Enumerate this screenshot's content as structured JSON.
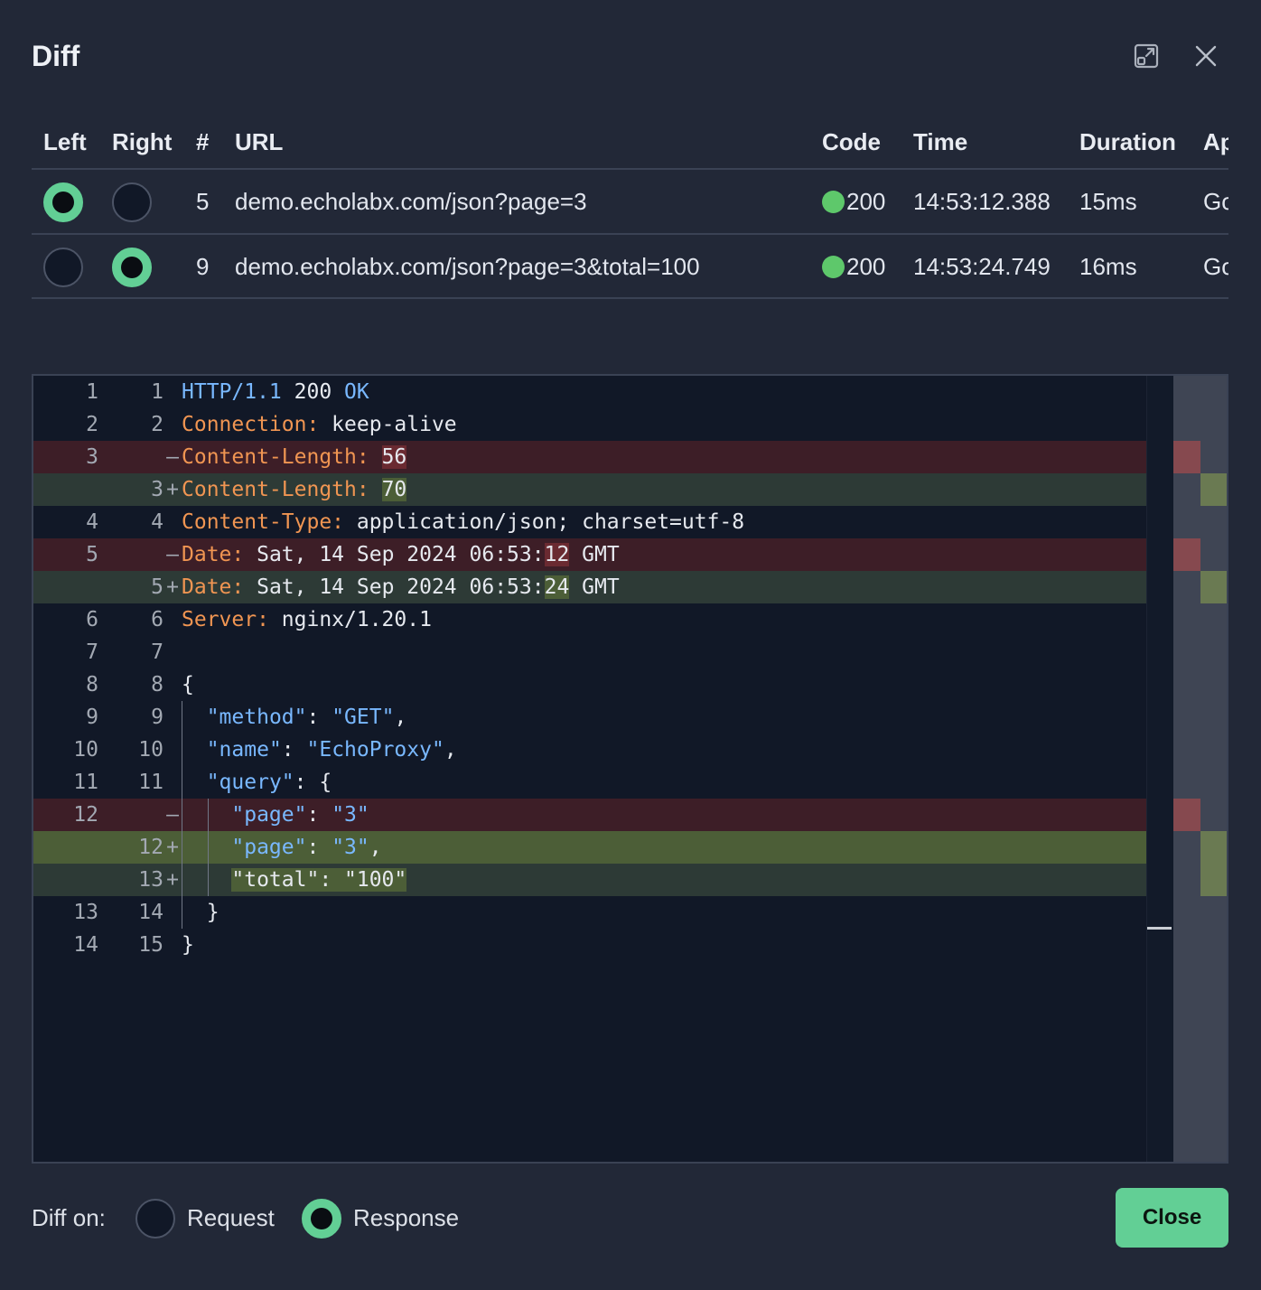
{
  "dialog": {
    "title": "Diff",
    "expand_icon": "expand-icon",
    "close_icon": "close-icon"
  },
  "table": {
    "headers": [
      "Left",
      "Right",
      "#",
      "URL",
      "Code",
      "Time",
      "Duration",
      "Ap"
    ],
    "rows": [
      {
        "left_selected": true,
        "right_selected": false,
        "num": "5",
        "url": "demo.echolabx.com/json?page=3",
        "code": "200",
        "time": "14:53:12.388",
        "duration": "15ms",
        "app": "Go"
      },
      {
        "left_selected": false,
        "right_selected": true,
        "num": "9",
        "url": "demo.echolabx.com/json?page=3&total=100",
        "code": "200",
        "time": "14:53:24.749",
        "duration": "16ms",
        "app": "Go"
      }
    ],
    "status_color": "#5ec86b"
  },
  "diff": {
    "lines": [
      {
        "l": "1",
        "r": "1",
        "mark": "",
        "type": "same",
        "parts": [
          [
            "b",
            "HTTP/1.1 "
          ],
          [
            "n",
            "200"
          ],
          [
            "b",
            " OK"
          ]
        ]
      },
      {
        "l": "2",
        "r": "2",
        "mark": "",
        "type": "same",
        "parts": [
          [
            "k",
            "Connection:"
          ],
          [
            "w",
            " keep-alive"
          ]
        ]
      },
      {
        "l": "3",
        "r": "",
        "mark": "—",
        "type": "del",
        "parts": [
          [
            "k",
            "Content-Length:"
          ],
          [
            "w",
            " "
          ],
          [
            "hd",
            "56"
          ]
        ]
      },
      {
        "l": "",
        "r": "3",
        "mark": "+",
        "type": "add",
        "parts": [
          [
            "k",
            "Content-Length:"
          ],
          [
            "w",
            " "
          ],
          [
            "ha",
            "70"
          ]
        ]
      },
      {
        "l": "4",
        "r": "4",
        "mark": "",
        "type": "same",
        "parts": [
          [
            "k",
            "Content-Type:"
          ],
          [
            "w",
            " application/json; charset=utf-8"
          ]
        ]
      },
      {
        "l": "5",
        "r": "",
        "mark": "—",
        "type": "del",
        "parts": [
          [
            "k",
            "Date:"
          ],
          [
            "w",
            " Sat, 14 Sep 2024 06:53:"
          ],
          [
            "hd",
            "12"
          ],
          [
            "w",
            " GMT"
          ]
        ]
      },
      {
        "l": "",
        "r": "5",
        "mark": "+",
        "type": "add",
        "parts": [
          [
            "k",
            "Date:"
          ],
          [
            "w",
            " Sat, 14 Sep 2024 06:53:"
          ],
          [
            "ha",
            "24"
          ],
          [
            "w",
            " GMT"
          ]
        ]
      },
      {
        "l": "6",
        "r": "6",
        "mark": "",
        "type": "same",
        "parts": [
          [
            "k",
            "Server:"
          ],
          [
            "w",
            " nginx/1.20.1"
          ]
        ]
      },
      {
        "l": "7",
        "r": "7",
        "mark": "",
        "type": "same",
        "parts": []
      },
      {
        "l": "8",
        "r": "8",
        "mark": "",
        "type": "same",
        "parts": [
          [
            "w",
            "{"
          ]
        ]
      },
      {
        "l": "9",
        "r": "9",
        "mark": "",
        "type": "same",
        "indent": 1,
        "parts": [
          [
            "w",
            "  "
          ],
          [
            "b",
            "\"method\""
          ],
          [
            "w",
            ": "
          ],
          [
            "b",
            "\"GET\""
          ],
          [
            "w",
            ","
          ]
        ]
      },
      {
        "l": "10",
        "r": "10",
        "mark": "",
        "type": "same",
        "indent": 1,
        "parts": [
          [
            "w",
            "  "
          ],
          [
            "b",
            "\"name\""
          ],
          [
            "w",
            ": "
          ],
          [
            "b",
            "\"EchoProxy\""
          ],
          [
            "w",
            ","
          ]
        ]
      },
      {
        "l": "11",
        "r": "11",
        "mark": "",
        "type": "same",
        "indent": 1,
        "parts": [
          [
            "w",
            "  "
          ],
          [
            "b",
            "\"query\""
          ],
          [
            "w",
            ": {"
          ]
        ]
      },
      {
        "l": "12",
        "r": "",
        "mark": "—",
        "type": "del",
        "indent": 2,
        "parts": [
          [
            "w",
            "    "
          ],
          [
            "b",
            "\"page\""
          ],
          [
            "w",
            ": "
          ],
          [
            "b",
            "\"3\""
          ]
        ]
      },
      {
        "l": "",
        "r": "12",
        "mark": "+",
        "type": "add2",
        "indent": 2,
        "parts": [
          [
            "w",
            "    "
          ],
          [
            "b",
            "\"page\""
          ],
          [
            "w",
            ": "
          ],
          [
            "b",
            "\"3\""
          ],
          [
            "w",
            ","
          ]
        ]
      },
      {
        "l": "",
        "r": "13",
        "mark": "+",
        "type": "add",
        "indent": 2,
        "parts": [
          [
            "w",
            "    "
          ],
          [
            "ha",
            "\"total\": \"100\""
          ]
        ]
      },
      {
        "l": "13",
        "r": "14",
        "mark": "",
        "type": "same",
        "indent": 1,
        "parts": [
          [
            "w",
            "  }"
          ]
        ]
      },
      {
        "l": "14",
        "r": "15",
        "mark": "",
        "type": "same",
        "parts": [
          [
            "w",
            "}"
          ]
        ]
      }
    ]
  },
  "footer": {
    "label": "Diff on:",
    "option_request": "Request",
    "option_response": "Response",
    "selected": "Response",
    "close_label": "Close"
  },
  "colors": {
    "accent": "#62cf95",
    "background": "#222837",
    "editor_bg": "#111827",
    "deleted_line": "#3d1e27",
    "added_line": "#2d3a36"
  }
}
